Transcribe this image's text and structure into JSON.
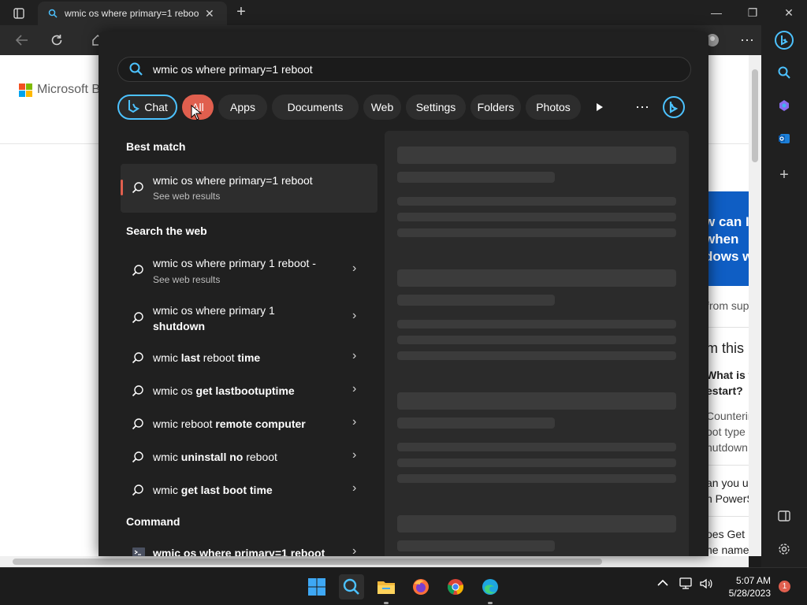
{
  "browser": {
    "tab_title": "wmic os where primary=1 reboo",
    "tab_close": "✕",
    "new_tab": "+",
    "window_controls": [
      "—",
      "❐",
      "✕"
    ]
  },
  "page": {
    "brand": "Microsoft Bing",
    "hero_lines": [
      "w can I",
      "when",
      "dows w"
    ],
    "texts": [
      "from sup",
      "m this p",
      "What is th",
      "estart?",
      "Counterin",
      "oot type",
      "hutdown",
      "an you u",
      "n PowerS",
      "oes Get",
      "he name"
    ]
  },
  "search": {
    "query": "wmic os where primary=1 reboot",
    "filters": [
      "Chat",
      "All",
      "Apps",
      "Documents",
      "Web",
      "Settings",
      "Folders",
      "Photos"
    ],
    "active_filter": "All",
    "sections": {
      "best_match": "Best match",
      "search_web": "Search the web",
      "command": "Command"
    },
    "best_match": {
      "title": "wmic os where primary=1 reboot",
      "subtitle": "See web results"
    },
    "web_results": [
      {
        "parts": [
          {
            "t": "wmic os where primary 1 reboot -",
            "b": false
          }
        ],
        "sub": "See web results"
      },
      {
        "parts": [
          {
            "t": "wmic os where primary 1",
            "b": false
          }
        ],
        "line2": "shutdown"
      },
      {
        "parts": [
          {
            "t": "wmic ",
            "b": false
          },
          {
            "t": "last",
            "b": true
          },
          {
            "t": " reboot ",
            "b": false
          },
          {
            "t": "time",
            "b": true
          }
        ]
      },
      {
        "parts": [
          {
            "t": "wmic os ",
            "b": false
          },
          {
            "t": "get lastbootuptime",
            "b": true
          }
        ]
      },
      {
        "parts": [
          {
            "t": "wmic reboot ",
            "b": false
          },
          {
            "t": "remote computer",
            "b": true
          }
        ]
      },
      {
        "parts": [
          {
            "t": "wmic ",
            "b": false
          },
          {
            "t": "uninstall no",
            "b": true
          },
          {
            "t": " reboot",
            "b": false
          }
        ]
      },
      {
        "parts": [
          {
            "t": "wmic ",
            "b": false
          },
          {
            "t": "get last boot time",
            "b": true
          }
        ]
      }
    ],
    "command_result": "wmic os where primary=1 reboot"
  },
  "taskbar": {
    "time": "5:07 AM",
    "date": "5/28/2023",
    "notifications": "1"
  },
  "colors": {
    "accent": "#e05f4e",
    "chat_border": "#4cc2ff",
    "hero_blue": "#0f5ec4"
  }
}
